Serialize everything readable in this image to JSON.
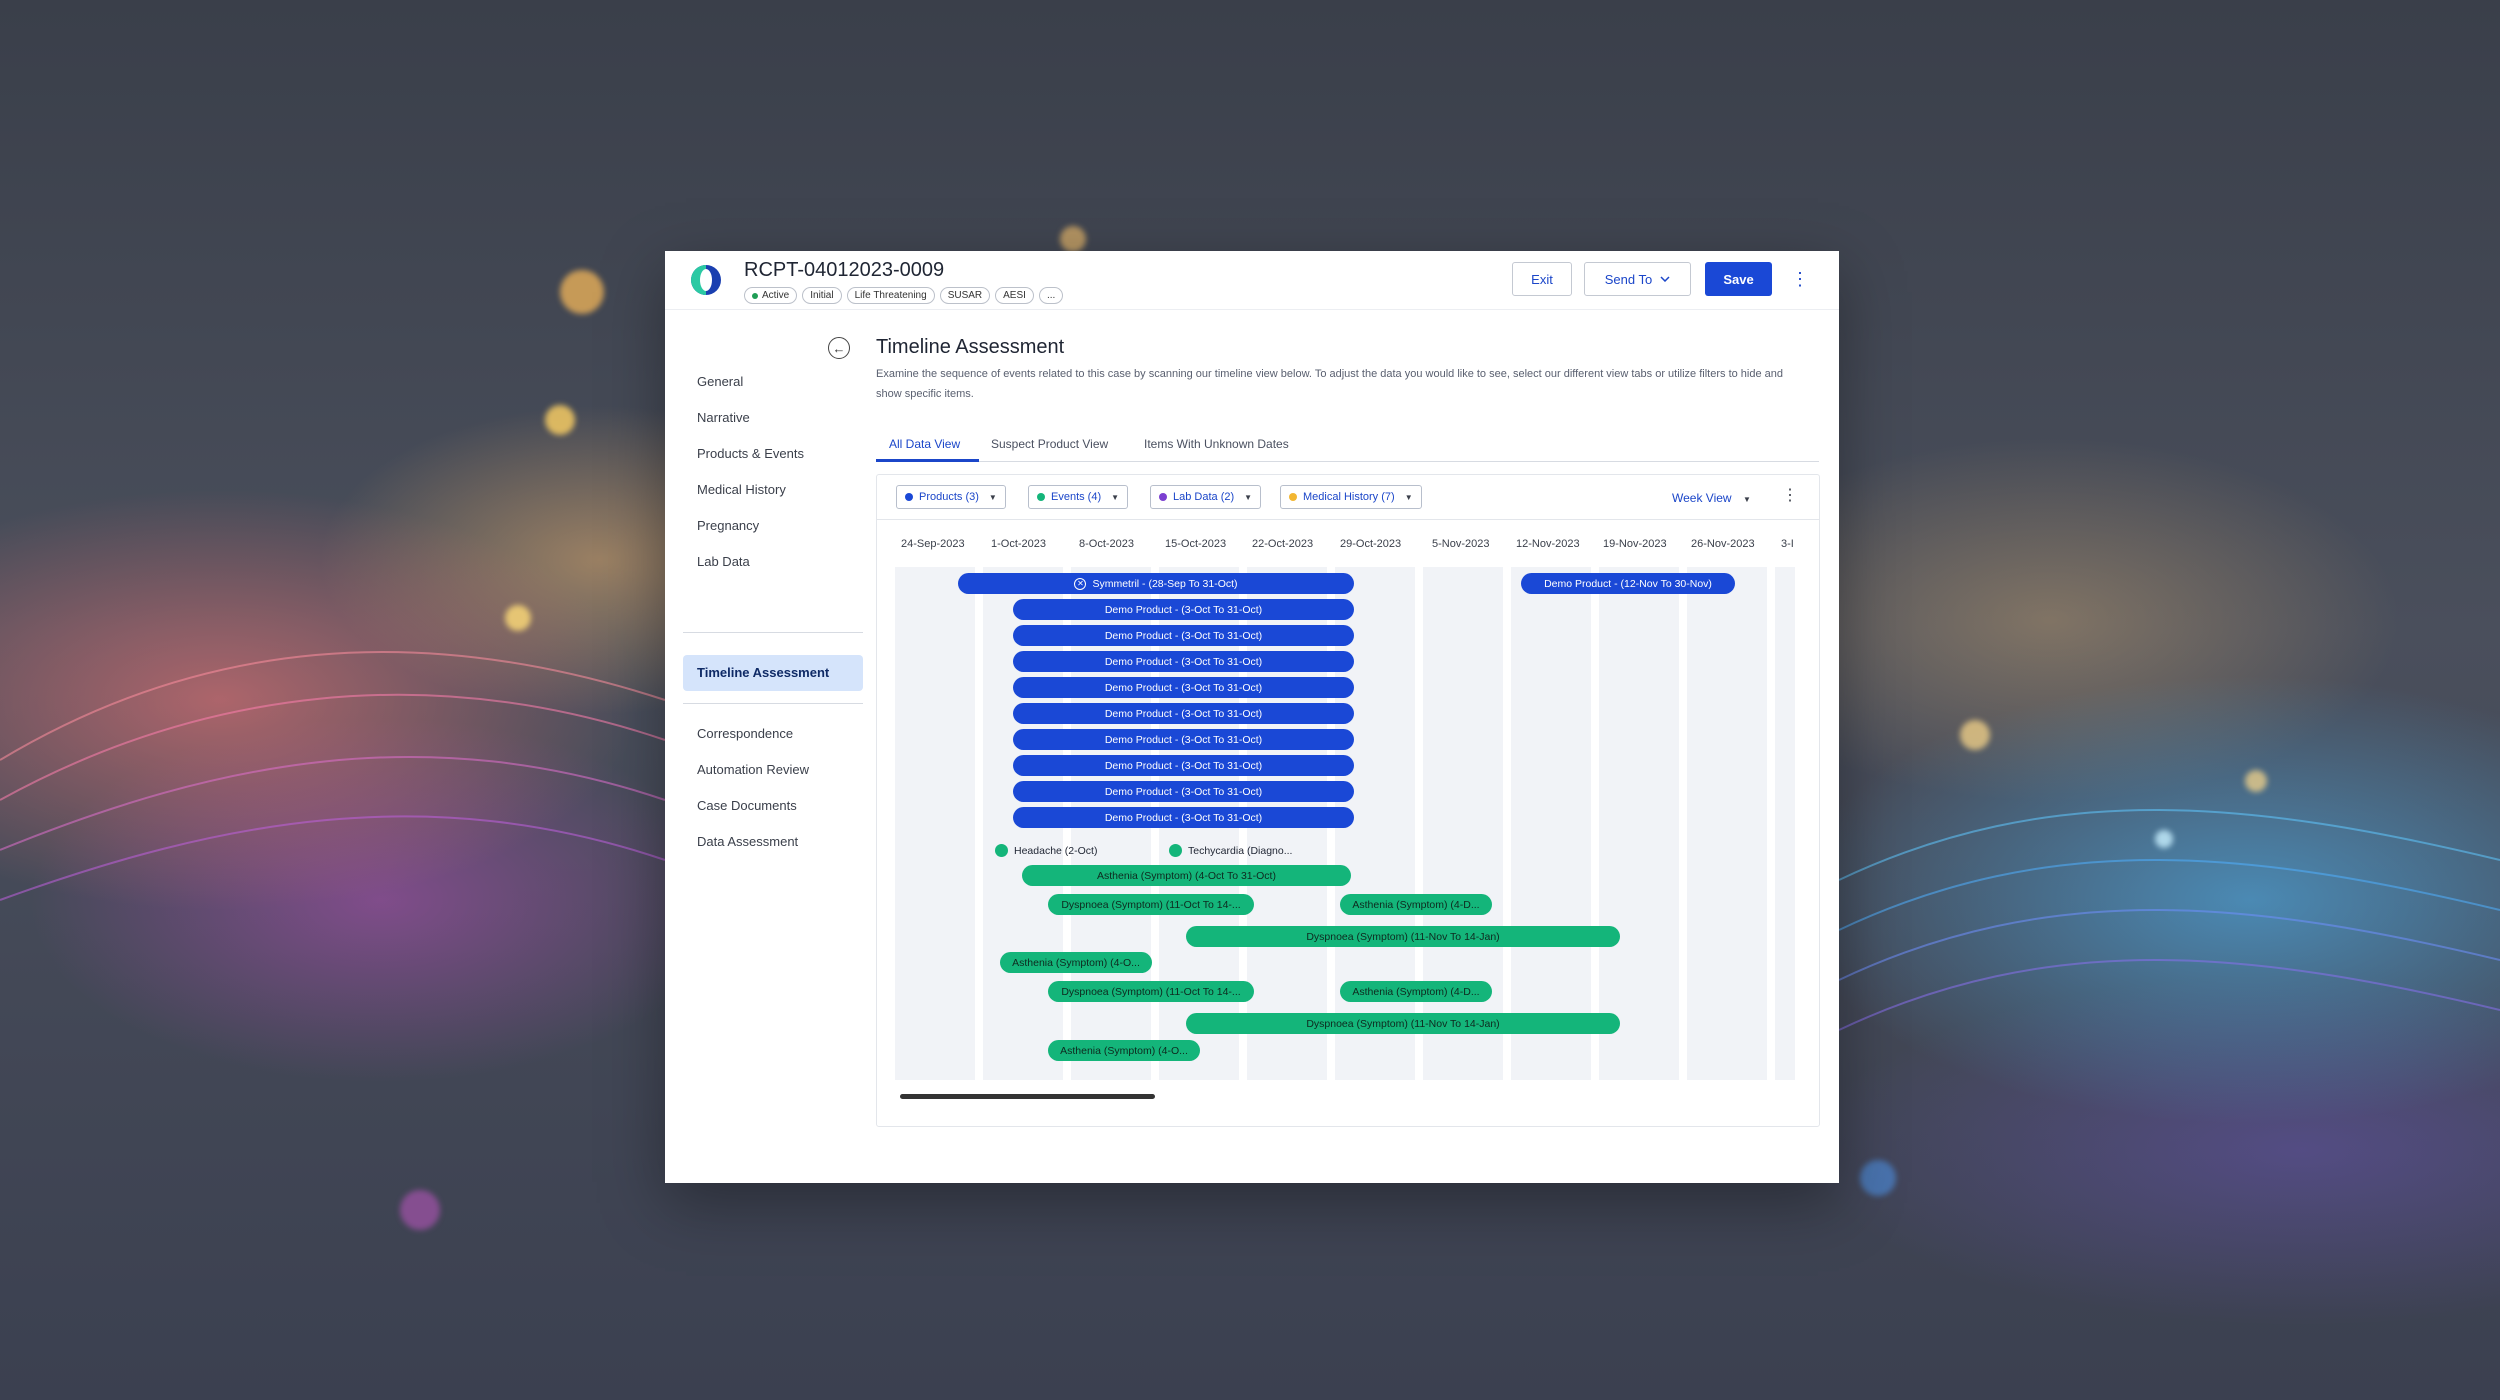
{
  "header": {
    "case_id": "RCPT-04012023-0009",
    "tags": [
      "Active",
      "Initial",
      "Life Threatening",
      "SUSAR",
      "AESI",
      "..."
    ],
    "exit_label": "Exit",
    "send_label": "Send To",
    "save_label": "Save"
  },
  "sidebar": {
    "items": [
      "General",
      "Narrative",
      "Products & Events",
      "Medical History",
      "Pregnancy",
      "Lab Data"
    ],
    "active": "Timeline Assessment",
    "items_lower": [
      "Correspondence",
      "Automation Review",
      "Case Documents",
      "Data Assessment"
    ]
  },
  "main": {
    "title": "Timeline Assessment",
    "description": "Examine the sequence of events related to this case by scanning our timeline view below. To adjust the data you would like to see, select our different view tabs or utilize filters to hide and show specific items.",
    "tabs": [
      "All Data View",
      "Suspect Product View",
      "Items With Unknown Dates"
    ],
    "filters": [
      "Products (3)",
      "Events (4)",
      "Lab Data (2)",
      "Medical History (7)"
    ],
    "view_select": "Week View"
  },
  "colors": {
    "product": "#1a48d6",
    "event": "#14b57a",
    "lab": "#7b3fd1",
    "history": "#f2b632"
  },
  "timeline": {
    "dates": [
      "24-Sep-2023",
      "1-Oct-2023",
      "8-Oct-2023",
      "15-Oct-2023",
      "22-Oct-2023",
      "29-Oct-2023",
      "5-Nov-2023",
      "12-Nov-2023",
      "19-Nov-2023",
      "26-Nov-2023",
      "3-I"
    ],
    "products": [
      "Symmetril - (28-Sep To 31-Oct)",
      "Demo Product - (12-Nov To 30-Nov)",
      "Demo Product - (3-Oct To 31-Oct)",
      "Demo Product - (3-Oct To 31-Oct)",
      "Demo Product - (3-Oct To 31-Oct)",
      "Demo Product - (3-Oct To 31-Oct)",
      "Demo Product - (3-Oct To 31-Oct)",
      "Demo Product - (3-Oct To 31-Oct)",
      "Demo Product - (3-Oct To 31-Oct)",
      "Demo Product - (3-Oct To 31-Oct)",
      "Demo Product - (3-Oct To 31-Oct)"
    ],
    "points": [
      "Headache (2-Oct)",
      "Techycardia (Diagno..."
    ],
    "events": [
      "Asthenia (Symptom) (4-Oct To 31-Oct)",
      "Dyspnoea (Symptom) (11-Oct To 14-...",
      "Asthenia (Symptom) (4-D...",
      "Dyspnoea (Symptom) (11-Nov To 14-Jan)",
      "Asthenia (Symptom) (4-O...",
      "Dyspnoea (Symptom) (11-Oct To 14-...",
      "Asthenia (Symptom) (4-D...",
      "Dyspnoea (Symptom) (11-Nov To 14-Jan)",
      "Asthenia (Symptom) (4-O..."
    ]
  }
}
